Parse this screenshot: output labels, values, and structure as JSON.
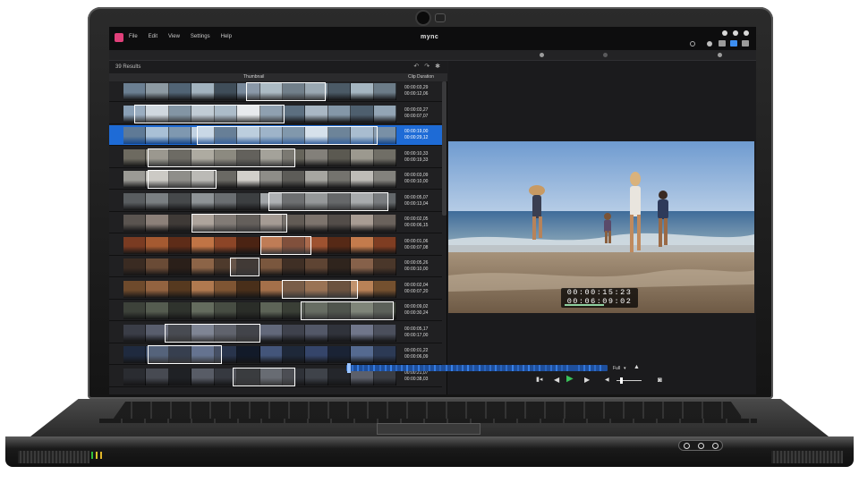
{
  "app": {
    "brand": "mync",
    "menu": [
      "File",
      "Edit",
      "View",
      "Settings",
      "Help"
    ]
  },
  "results": {
    "label": "39 Results"
  },
  "columns": {
    "thumbnail": "Thumbnail",
    "clip_duration": "Clip Duration"
  },
  "clips": [
    {
      "line1": "00:00:03,29",
      "line2": "00:00:12,06",
      "palette": [
        "#6b7f92",
        "#8d9aa3",
        "#516475",
        "#a2b3bf",
        "#3f4d59",
        "#77889a",
        "#9fb0bb",
        "#5a6a77",
        "#8a9aa6",
        "#4b5a66",
        "#a5b6c1",
        "#6c7c88"
      ],
      "hl_start": 0.45,
      "hl_end": 0.74,
      "selected": false
    },
    {
      "line1": "00:00:03,27",
      "line2": "00:00:07,07",
      "palette": [
        "#8aa0b6",
        "#c9d2da",
        "#6f8496",
        "#b7c4cf",
        "#9fb1c1",
        "#e3e7ea",
        "#7d91a3",
        "#5c6f80",
        "#a9b7c4",
        "#8497a8",
        "#4e5f6e",
        "#93a5b5"
      ],
      "hl_start": 0.04,
      "hl_end": 0.59,
      "selected": false
    },
    {
      "line1": "00:00:19,00",
      "line2": "00:00:29,12",
      "palette": [
        "#5f7a96",
        "#a9c0d6",
        "#7f98b0",
        "#c1d2e2",
        "#4f6a86",
        "#b2c6d9",
        "#8ea8c0",
        "#6d879f",
        "#d0dde8",
        "#567089",
        "#9bb3c9",
        "#7990a6"
      ],
      "hl_start": 0.27,
      "hl_end": 0.93,
      "selected": true
    },
    {
      "line1": "00:00:10,33",
      "line2": "00:00:19,33",
      "palette": [
        "#6d6a60",
        "#8b887d",
        "#55534b",
        "#a19e92",
        "#7a776c",
        "#4a4842",
        "#96938a",
        "#66645b",
        "#83807a",
        "#5b5951",
        "#9c998f",
        "#706e66"
      ],
      "hl_start": 0.09,
      "hl_end": 0.63,
      "selected": false
    },
    {
      "line1": "00:00:03,09",
      "line2": "00:00:10,00",
      "palette": [
        "#9b9a95",
        "#c4c2bc",
        "#7d7c77",
        "#b0afaa",
        "#6a6964",
        "#d2d0cb",
        "#8e8d88",
        "#5d5c58",
        "#a7a6a1",
        "#74736e",
        "#bebcb7",
        "#83827d"
      ],
      "hl_start": 0.09,
      "hl_end": 0.34,
      "selected": false
    },
    {
      "line1": "00:00:05,07",
      "line2": "00:00:13,04",
      "palette": [
        "#595d60",
        "#7a7f82",
        "#46494b",
        "#8e9396",
        "#6a6e71",
        "#3c3f41",
        "#a1a5a8",
        "#55585a",
        "#848889",
        "#4d5052",
        "#9a9ea0",
        "#63676a"
      ],
      "hl_start": 0.53,
      "hl_end": 0.97,
      "selected": false
    },
    {
      "line1": "00:00:02,05",
      "line2": "00:00:06,15",
      "palette": [
        "#5a5450",
        "#8c8079",
        "#3f3a37",
        "#a1958c",
        "#6e6660",
        "#4b4541",
        "#978b83",
        "#625b55",
        "#7d746d",
        "#534d49",
        "#a89c93",
        "#6a625c"
      ],
      "hl_start": 0.25,
      "hl_end": 0.6,
      "selected": false
    },
    {
      "line1": "00:00:01,06",
      "line2": "00:00:07,08",
      "palette": [
        "#7a3b22",
        "#a55a31",
        "#5e2c18",
        "#c17445",
        "#8c4527",
        "#4b2313",
        "#b5673b",
        "#6d341d",
        "#9e5230",
        "#562916",
        "#c47b4c",
        "#7f3d22"
      ],
      "hl_start": 0.5,
      "hl_end": 0.69,
      "selected": false
    },
    {
      "line1": "00:00:05,26",
      "line2": "00:00:10,00",
      "palette": [
        "#3a2b22",
        "#6a4b36",
        "#2a1f19",
        "#8c6447",
        "#4e3a2c",
        "#221a15",
        "#7a573e",
        "#3f2f25",
        "#5e4433",
        "#2f241d",
        "#86614a",
        "#4a372a"
      ],
      "hl_start": 0.39,
      "hl_end": 0.5,
      "selected": false
    },
    {
      "line1": "00:00:02,04",
      "line2": "00:00:07,20",
      "palette": [
        "#6e4a2c",
        "#936340",
        "#56391f",
        "#b0794f",
        "#7f5533",
        "#492f1a",
        "#a4704a",
        "#64432a",
        "#8a5c3a",
        "#533620",
        "#b98257",
        "#74502f"
      ],
      "hl_start": 0.58,
      "hl_end": 0.86,
      "selected": false
    },
    {
      "line1": "00:00:09,02",
      "line2": "00:00:30,24",
      "palette": [
        "#3d423a",
        "#555c50",
        "#2f332d",
        "#646c5e",
        "#474d43",
        "#2a2d28",
        "#5d6457",
        "#3a3f36",
        "#4f564a",
        "#333830",
        "#6a7264",
        "#42483f"
      ],
      "hl_start": 0.65,
      "hl_end": 0.99,
      "selected": false
    },
    {
      "line1": "00:00:05,17",
      "line2": "00:00:17,00",
      "palette": [
        "#3a3d47",
        "#595e6d",
        "#2b2e36",
        "#6b7183",
        "#464a56",
        "#24262d",
        "#62687a",
        "#3f424d",
        "#535868",
        "#30333b",
        "#70768a",
        "#4b4f5c"
      ],
      "hl_start": 0.15,
      "hl_end": 0.5,
      "selected": false
    },
    {
      "line1": "00:00:01,22",
      "line2": "00:00:06,09",
      "palette": [
        "#1f2a3f",
        "#3a4a66",
        "#172033",
        "#4c5d7e",
        "#28344c",
        "#121a29",
        "#43557a",
        "#1e2839",
        "#35456a",
        "#1a2335",
        "#556a90",
        "#2c3a55"
      ],
      "hl_start": 0.09,
      "hl_end": 0.36,
      "selected": false
    },
    {
      "line1": "00:00:21,07",
      "line2": "00:00:38,03",
      "palette": [
        "#2a2c31",
        "#474a52",
        "#1f2125",
        "#585c66",
        "#363940",
        "#1a1c20",
        "#50545d",
        "#2f3238",
        "#3f434a",
        "#24262b",
        "#5c606b",
        "#3a3d44"
      ],
      "hl_start": 0.4,
      "hl_end": 0.63,
      "selected": false
    }
  ],
  "viewer": {
    "timecode_current": "00:00:15:23",
    "timecode_total": "00:06:09:02",
    "fit_label": "Full",
    "fit_arrow": "▾",
    "up_arrow": "▲"
  },
  "controls": {
    "prev_frame": "▮◂",
    "step_back": "◀",
    "play": "▶",
    "step_forward": "▶",
    "volume_icon": "◀",
    "snapshot": "◙"
  },
  "result_icons": {
    "undo": "↶",
    "redo": "↷",
    "settings": "✱"
  },
  "colors": {
    "selection": "#1e6bd6",
    "play": "#39c15a",
    "logo": "#e0407a",
    "timeline": "#1e4f9c"
  }
}
